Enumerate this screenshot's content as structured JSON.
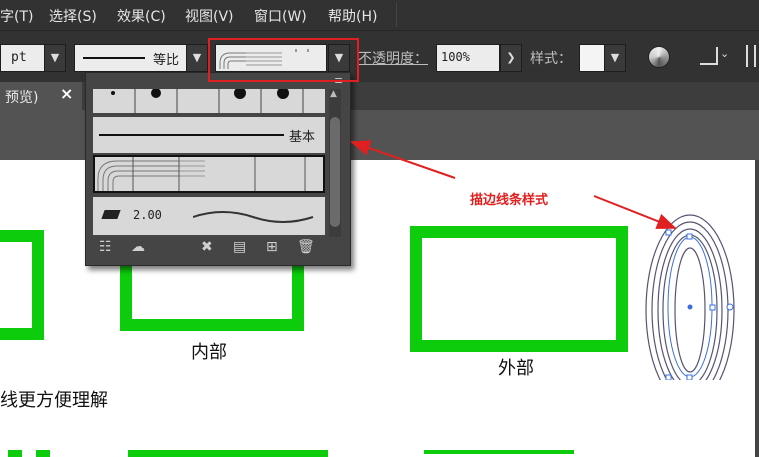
{
  "menubar": {
    "items": [
      "字(T)",
      "选择(S)",
      "效果(C)",
      "视图(V)",
      "窗口(W)",
      "帮助(H)"
    ]
  },
  "controlbar": {
    "stroke_unit": "pt",
    "profile_label": "等比",
    "opacity_label": "不透明度：",
    "opacity_value": "100%",
    "style_label": "样式："
  },
  "tabs": {
    "doc_tab_label": "预览)",
    "close_glyph": "×"
  },
  "popup": {
    "basic_label": "基本",
    "weight_value": "2.00"
  },
  "canvas": {
    "inner_caption": "内部",
    "outer_caption": "外部",
    "partial_text": "线更方便理解"
  },
  "annotation": {
    "text": "描边线条样式",
    "color": "#e02020"
  },
  "colors": {
    "menubar_bg": "#323232",
    "workspace_bg": "#535353",
    "green_rect": "#0ccc0c",
    "highlight_red": "#e02020",
    "selection_blue": "#3b6fe0"
  }
}
